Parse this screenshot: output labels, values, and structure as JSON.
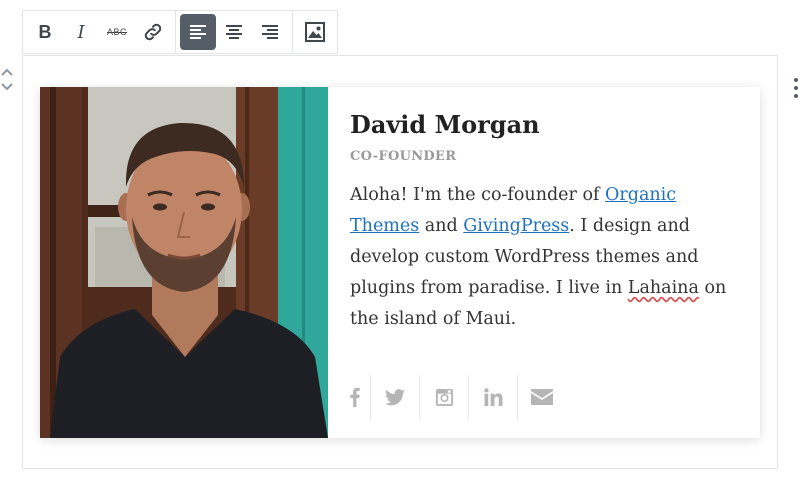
{
  "toolbar": {
    "bold": "B",
    "italic": "I",
    "strikethrough": "ABC"
  },
  "profile": {
    "name": "David Morgan",
    "role": "CO-FOUNDER",
    "bio": {
      "t1": "Aloha! I'm the co-founder of ",
      "link1": "Organic Themes",
      "t2": " and ",
      "link2": "GivingPress",
      "t3": ". I design and develop custom WordPress themes and plugins from paradise. I live in ",
      "spell": "Lahaina",
      "t4": " on the island of Maui."
    },
    "social_icons": [
      "facebook-icon",
      "twitter-icon",
      "instagram-icon",
      "linkedin-icon",
      "email-icon"
    ]
  },
  "colors": {
    "link": "#1e72bd",
    "active_tool": "#555d66",
    "social_icon": "#b5b5b5"
  }
}
